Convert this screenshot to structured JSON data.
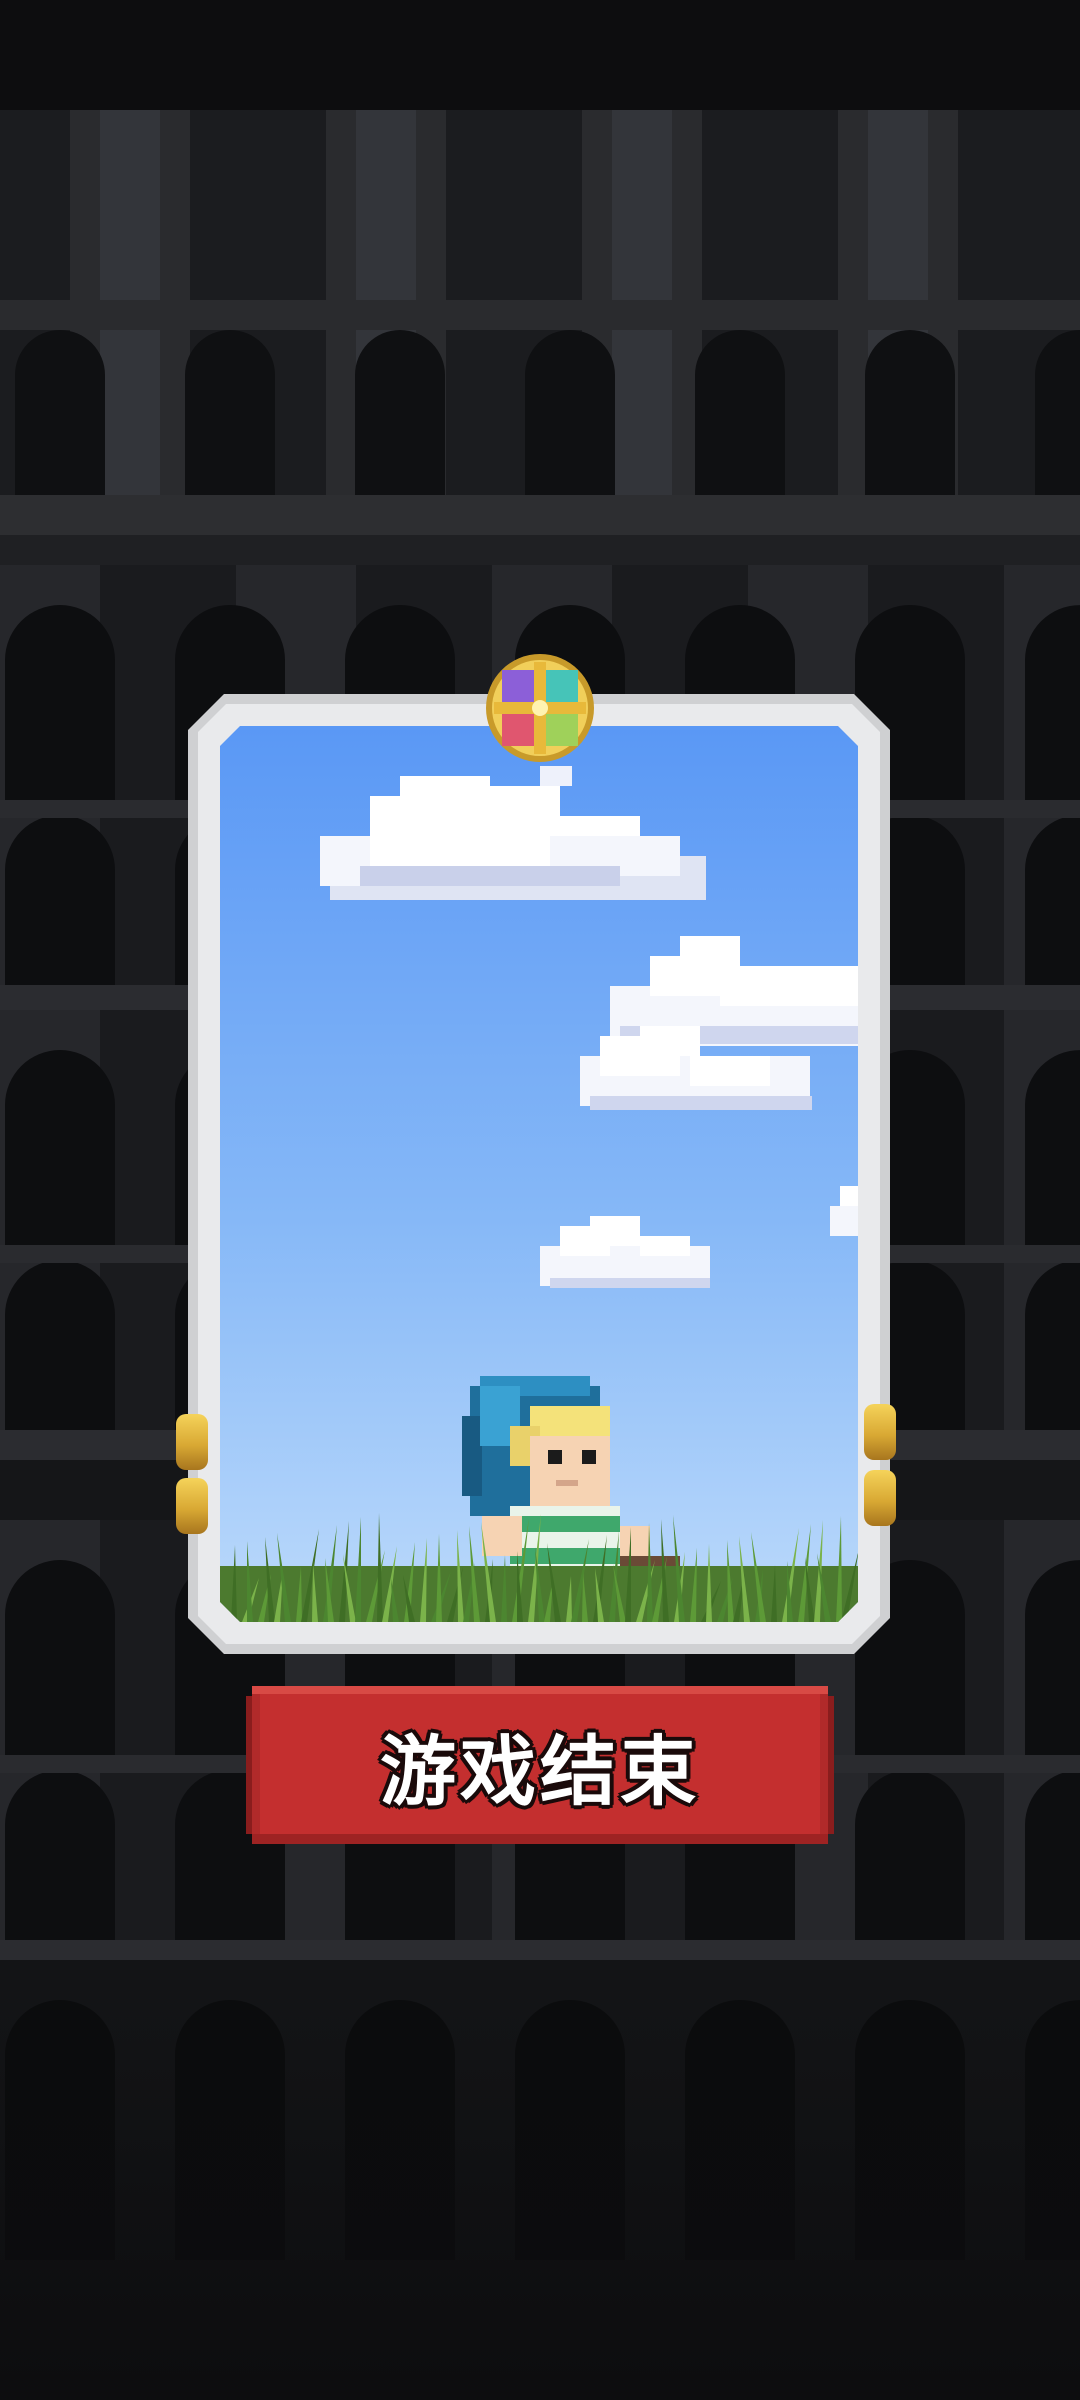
{
  "end_button": {
    "label": "游戏结束"
  },
  "icons": {
    "emblem": "class-emblem-icon",
    "character": "hero-character-icon",
    "clouds": "cloud-icon",
    "grass": "grass-icon"
  },
  "colors": {
    "sky_top": "#5a9af6",
    "sky_bottom": "#b7d7fa",
    "button": "#c42f2f",
    "card_frame": "#d4d5d7",
    "background": "#111214"
  }
}
